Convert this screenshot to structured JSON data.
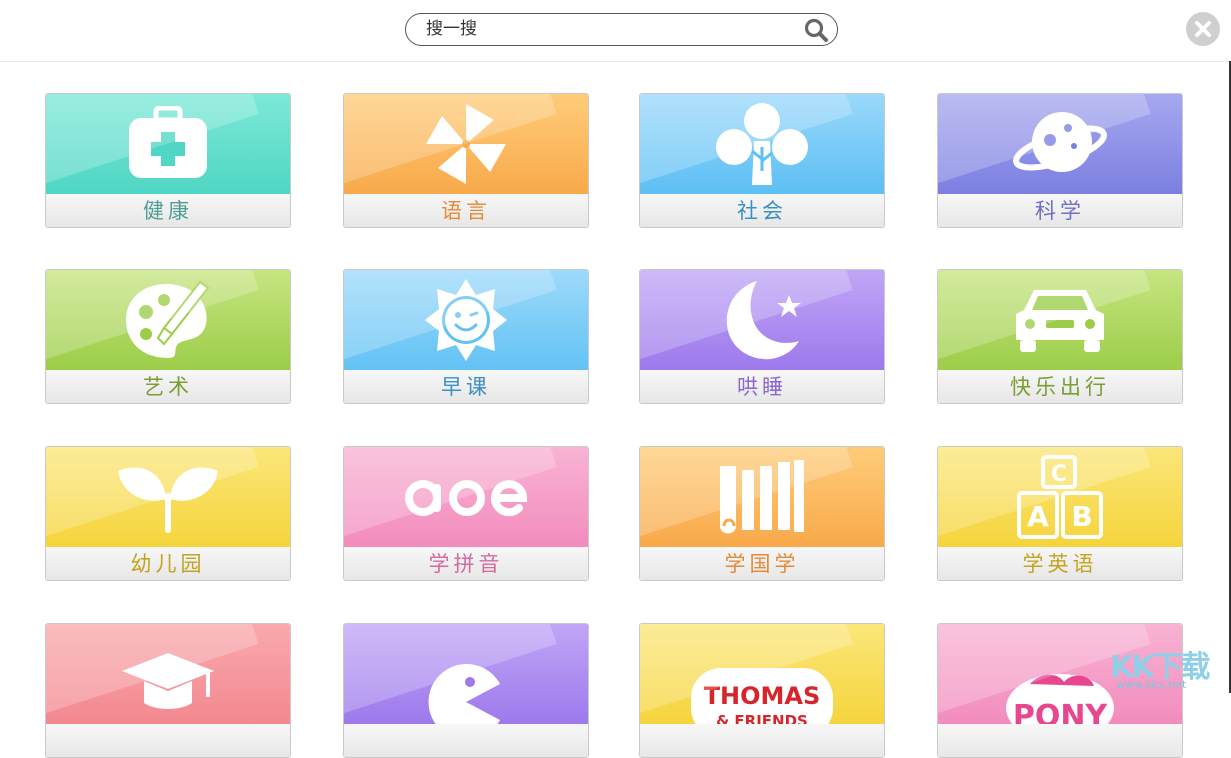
{
  "search": {
    "placeholder": "搜一搜"
  },
  "categories": [
    {
      "label": "健康",
      "icon": "medical-kit-icon",
      "color_top": "#7de8d8",
      "color_bottom": "#4fd6c4",
      "text_color": "#4f9e96"
    },
    {
      "label": "语言",
      "icon": "pinwheel-icon",
      "color_top": "#ffcc7a",
      "color_bottom": "#f8a94a",
      "text_color": "#e58a36"
    },
    {
      "label": "社会",
      "icon": "tree-icon",
      "color_top": "#9ad9fb",
      "color_bottom": "#5dbff4",
      "text_color": "#3a8fc4"
    },
    {
      "label": "科学",
      "icon": "planet-icon",
      "color_top": "#a6a8f0",
      "color_bottom": "#7c7fe0",
      "text_color": "#6e70c6"
    },
    {
      "label": "艺术",
      "icon": "palette-icon",
      "color_top": "#c6e581",
      "color_bottom": "#9ccd48",
      "text_color": "#7a9e33"
    },
    {
      "label": "早课",
      "icon": "sun-icon",
      "color_top": "#9ddafb",
      "color_bottom": "#63c2f4",
      "text_color": "#3a8fc4"
    },
    {
      "label": "哄睡",
      "icon": "moon-icon",
      "color_top": "#c0a6f6",
      "color_bottom": "#9d79ec",
      "text_color": "#8a67cf"
    },
    {
      "label": "快乐出行",
      "icon": "car-icon",
      "color_top": "#c6e581",
      "color_bottom": "#9ccd48",
      "text_color": "#7a9e33"
    },
    {
      "label": "幼儿园",
      "icon": "sprout-icon",
      "color_top": "#fbe77a",
      "color_bottom": "#f5d43c",
      "text_color": "#c4a41f"
    },
    {
      "label": "学拼音",
      "icon": "aoe-icon",
      "color_top": "#f9b3d3",
      "color_bottom": "#f28cbd",
      "text_color": "#d46aa0"
    },
    {
      "label": "学国学",
      "icon": "scroll-icon",
      "color_top": "#ffcc7a",
      "color_bottom": "#f8a94a",
      "text_color": "#e58a36"
    },
    {
      "label": "学英语",
      "icon": "abc-blocks-icon",
      "color_top": "#fbe77a",
      "color_bottom": "#f5d43c",
      "text_color": "#c4a41f"
    },
    {
      "label": "",
      "icon": "graduation-cap-icon",
      "color_top": "#f9a9ad",
      "color_bottom": "#f38890",
      "text_color": "#d46a70"
    },
    {
      "label": "",
      "icon": "pacman-icon",
      "color_top": "#c0a6f6",
      "color_bottom": "#9d79ec",
      "text_color": "#8a67cf"
    },
    {
      "label": "",
      "icon": "thomas-logo",
      "color_top": "#fbe77a",
      "color_bottom": "#f5d43c",
      "text_color": "#c4a41f",
      "logo_text": "THOMAS",
      "logo_subtext": "& FRIENDS"
    },
    {
      "label": "",
      "icon": "my-little-pony-logo",
      "color_top": "#f9b3d3",
      "color_bottom": "#f28cbd",
      "text_color": "#d46aa0",
      "logo_text": "PONY"
    }
  ],
  "watermark": {
    "text": "KK下载",
    "url": "www.kkx.net"
  }
}
